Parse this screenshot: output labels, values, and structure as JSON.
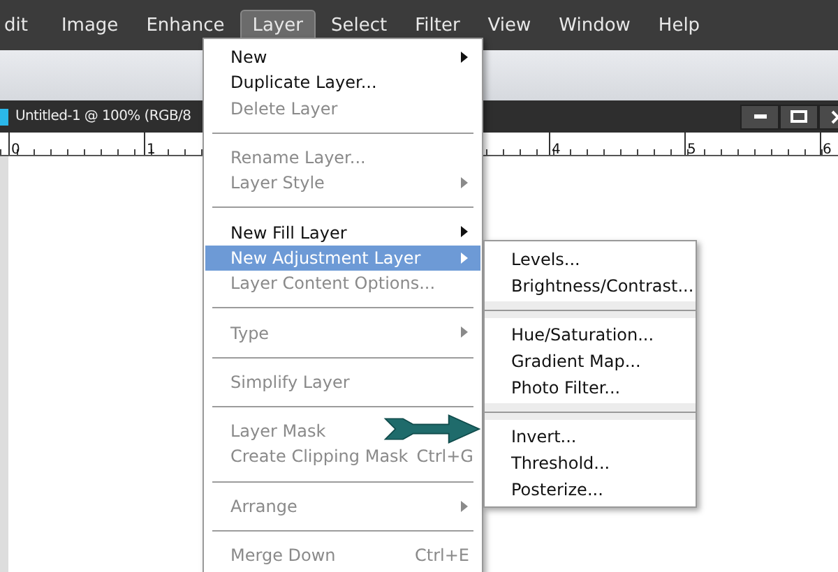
{
  "menubar": [
    {
      "label": "dit",
      "selected": false
    },
    {
      "label": "Image",
      "selected": false
    },
    {
      "label": "Enhance",
      "selected": false
    },
    {
      "label": "Layer",
      "selected": true
    },
    {
      "label": "Select",
      "selected": false
    },
    {
      "label": "Filter",
      "selected": false
    },
    {
      "label": "View",
      "selected": false
    },
    {
      "label": "Window",
      "selected": false
    },
    {
      "label": "Help",
      "selected": false
    }
  ],
  "document": {
    "title": "Untitled-1 @ 100% (RGB/8"
  },
  "ruler": {
    "left_labels": [
      "0",
      "1"
    ],
    "right_labels": [
      "4",
      "5",
      "6"
    ]
  },
  "menu": [
    {
      "kind": "item",
      "label": "New",
      "disabled": false,
      "submenu": true,
      "selected": false
    },
    {
      "kind": "item",
      "label": "Duplicate Layer...",
      "disabled": false,
      "submenu": false,
      "selected": false
    },
    {
      "kind": "item",
      "label": "Delete Layer",
      "disabled": true,
      "submenu": false,
      "selected": false
    },
    {
      "kind": "separator"
    },
    {
      "kind": "item",
      "label": "Rename Layer...",
      "disabled": true,
      "submenu": false,
      "selected": false
    },
    {
      "kind": "item",
      "label": "Layer Style",
      "disabled": true,
      "submenu": true,
      "selected": false
    },
    {
      "kind": "separator"
    },
    {
      "kind": "item",
      "label": "New Fill Layer",
      "disabled": false,
      "submenu": true,
      "selected": false
    },
    {
      "kind": "item",
      "label": "New Adjustment Layer",
      "disabled": false,
      "submenu": true,
      "selected": true
    },
    {
      "kind": "item",
      "label": "Layer Content Options...",
      "disabled": true,
      "submenu": false,
      "selected": false
    },
    {
      "kind": "separator"
    },
    {
      "kind": "item",
      "label": "Type",
      "disabled": true,
      "submenu": true,
      "selected": false
    },
    {
      "kind": "separator"
    },
    {
      "kind": "item",
      "label": "Simplify Layer",
      "disabled": true,
      "submenu": false,
      "selected": false
    },
    {
      "kind": "separator"
    },
    {
      "kind": "item",
      "label": "Layer Mask",
      "disabled": true,
      "submenu": false,
      "selected": false
    },
    {
      "kind": "item",
      "label": "Create Clipping Mask",
      "shortcut": "Ctrl+G",
      "disabled": true,
      "submenu": false,
      "selected": false
    },
    {
      "kind": "separator"
    },
    {
      "kind": "item",
      "label": "Arrange",
      "disabled": true,
      "submenu": true,
      "selected": false
    },
    {
      "kind": "separator"
    },
    {
      "kind": "item",
      "label": "Merge Down",
      "shortcut": "Ctrl+E",
      "disabled": true,
      "submenu": false,
      "selected": false
    }
  ],
  "submenu": [
    {
      "kind": "item",
      "label": "Levels..."
    },
    {
      "kind": "item",
      "label": "Brightness/Contrast..."
    },
    {
      "kind": "separator"
    },
    {
      "kind": "item",
      "label": "Hue/Saturation..."
    },
    {
      "kind": "item",
      "label": "Gradient Map..."
    },
    {
      "kind": "item",
      "label": "Photo Filter..."
    },
    {
      "kind": "separator"
    },
    {
      "kind": "item",
      "label": "Invert..."
    },
    {
      "kind": "item",
      "label": "Threshold..."
    },
    {
      "kind": "item",
      "label": "Posterize..."
    }
  ]
}
